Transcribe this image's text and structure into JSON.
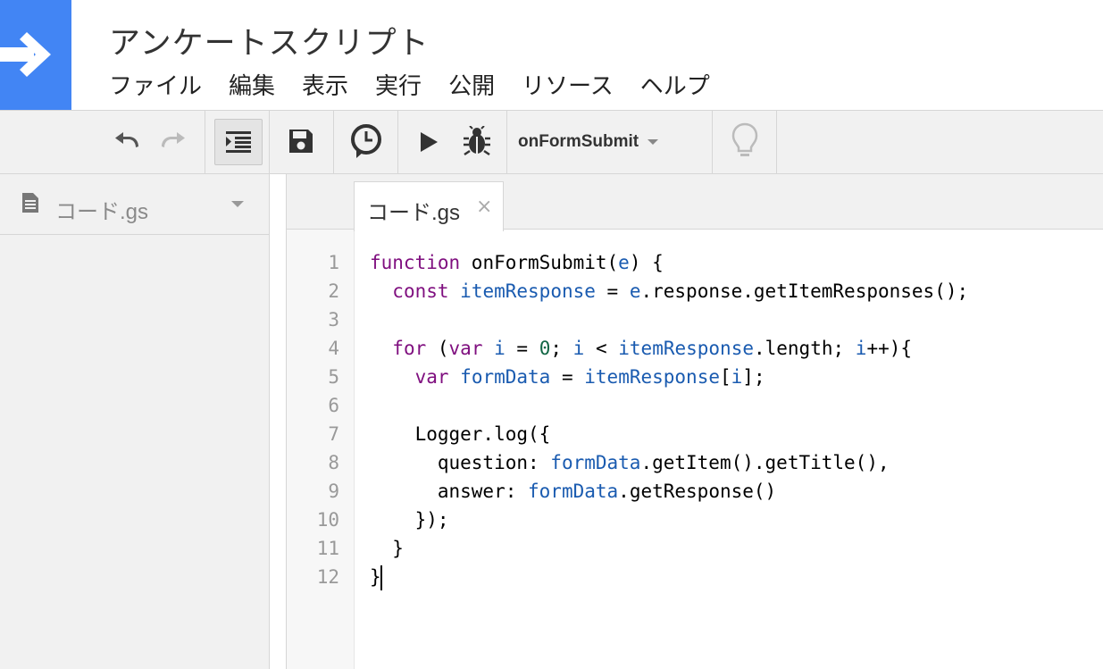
{
  "app": {
    "title": "アンケートスクリプト",
    "logo_icon": "arrow-right-icon",
    "brand_color": "#4285f4"
  },
  "menu": [
    "ファイル",
    "編集",
    "表示",
    "実行",
    "公開",
    "リソース",
    "ヘルプ"
  ],
  "toolbar": {
    "function_select": "onFormSubmit",
    "icons": [
      "undo-icon",
      "redo-icon",
      "indent-icon",
      "save-icon",
      "triggers-icon",
      "run-icon",
      "debug-icon",
      "lightbulb-icon"
    ]
  },
  "sidebar": {
    "file_name": "コード.gs"
  },
  "editor": {
    "tab_label": "コード.gs",
    "tab_close": "×",
    "line_numbers": [
      "1",
      "2",
      "3",
      "4",
      "5",
      "6",
      "7",
      "8",
      "9",
      "10",
      "11",
      "12"
    ],
    "code_lines": [
      "function onFormSubmit(e) {",
      "  const itemResponse = e.response.getItemResponses();",
      "",
      "  for (var i = 0; i < itemResponse.length; i++){",
      "    var formData = itemResponse[i];",
      "",
      "    Logger.log({",
      "      question: formData.getItem().getTitle(),",
      "      answer: formData.getResponse()",
      "    });",
      "  }",
      "}"
    ]
  }
}
